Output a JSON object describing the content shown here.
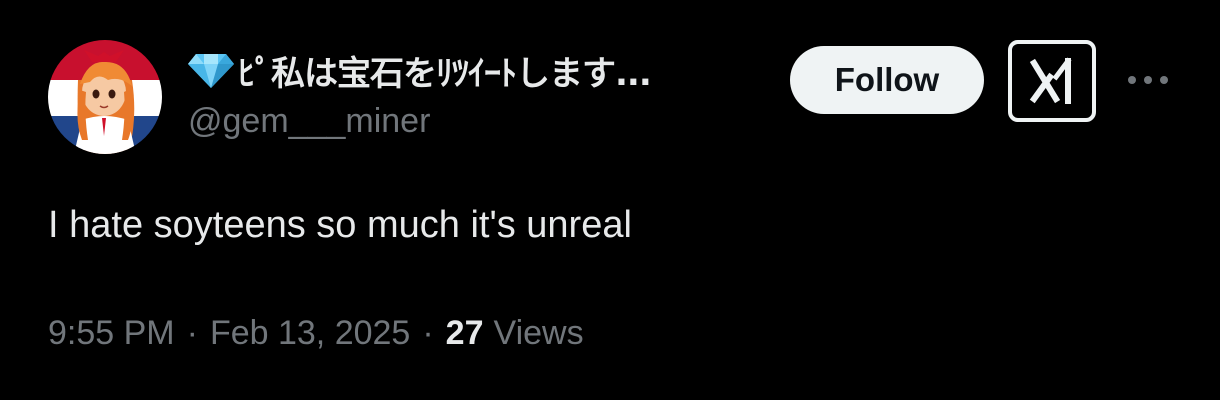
{
  "tweet": {
    "author": {
      "display_name": "ﾋﾟ私は宝石をﾘﾂｲｰﾄします...",
      "handle": "@gem___miner",
      "avatar_icon": "anime-girl-avatar",
      "name_emoji_icon": "gem-stone-icon"
    },
    "follow_label": "Follow",
    "grok_icon": "grok-icon",
    "more_icon": "more-options-icon",
    "text": "I hate soyteens so much it's unreal",
    "time": "9:55 PM",
    "separator": "·",
    "date": "Feb 13, 2025",
    "views_count": "27",
    "views_label": "Views"
  },
  "colors": {
    "background": "#000000",
    "primary_text": "#e7e9ea",
    "secondary_text": "#71767b",
    "follow_button_bg": "#eff3f4",
    "follow_button_text": "#0f1419",
    "gem": "#5bc6f5"
  }
}
